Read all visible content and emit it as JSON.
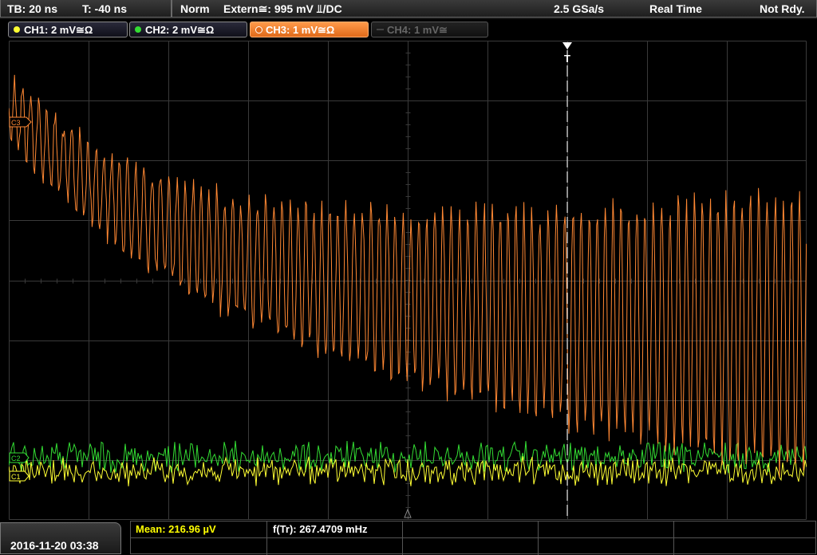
{
  "topbar": {
    "timebase": "TB: 20 ns",
    "trigger_time": "T: -40 ns",
    "mode": "Norm",
    "trigger_source": "Extern≅: 995 mV ⫫/DC",
    "sample_rate": "2.5 GSa/s",
    "acquisition": "Real Time",
    "status": "Not Rdy."
  },
  "channels": [
    {
      "label": "CH1: 2 mV≅Ω",
      "color": "#ffff33",
      "active": true
    },
    {
      "label": "CH2: 2 mV≅Ω",
      "color": "#33dd33",
      "active": true
    },
    {
      "label": "CH3: 1 mV≅Ω",
      "color": "#ff8833",
      "active": true,
      "selected": true
    },
    {
      "label": "CH4: 1 mV≅",
      "color": "#555555",
      "active": false
    }
  ],
  "markers": {
    "ch3_ref": "C3",
    "ch2_ref": "C2",
    "ch1_ref": "C1",
    "trigger": "T"
  },
  "measurements": {
    "mean": "Mean: 216.96 µV",
    "frequency": "f(Tr): 267.4709 mHz"
  },
  "datetime": "2016-11-20 03:38",
  "colors": {
    "ch1": "#ffff33",
    "ch2": "#33dd33",
    "ch3": "#ff8833",
    "grid": "#3a3a3a",
    "meas_label": "#ffff00"
  }
}
